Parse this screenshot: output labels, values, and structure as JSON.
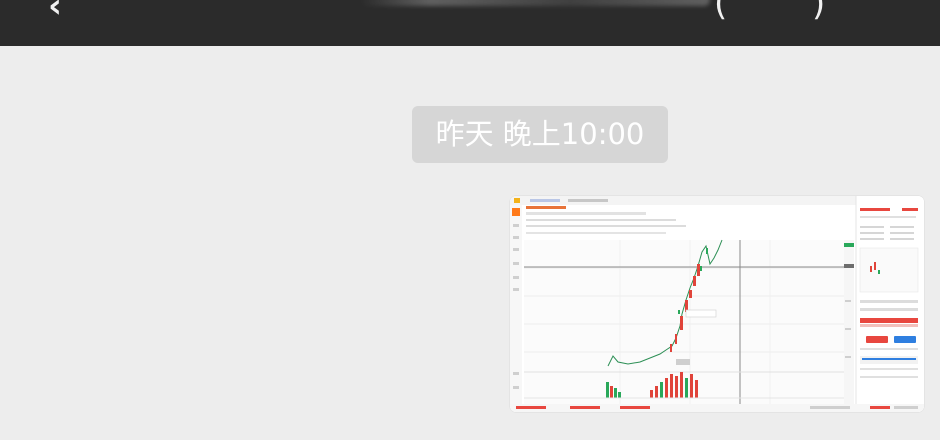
{
  "top_bar": {
    "back_icon": "chevron-left-icon",
    "title_open": "(",
    "title_close": ")",
    "back_glyph": "‹"
  },
  "chat": {
    "timestamp": "昨天 晚上10:00",
    "image_message": {
      "kind": "screenshot-thumbnail",
      "subject": "trading chart application",
      "colors": {
        "up_candle": "#e0443a",
        "down_candle": "#29a85a",
        "accent": "#ff7a1a",
        "button_red": "#e8473f",
        "button_blue": "#2f7fe0"
      }
    }
  }
}
